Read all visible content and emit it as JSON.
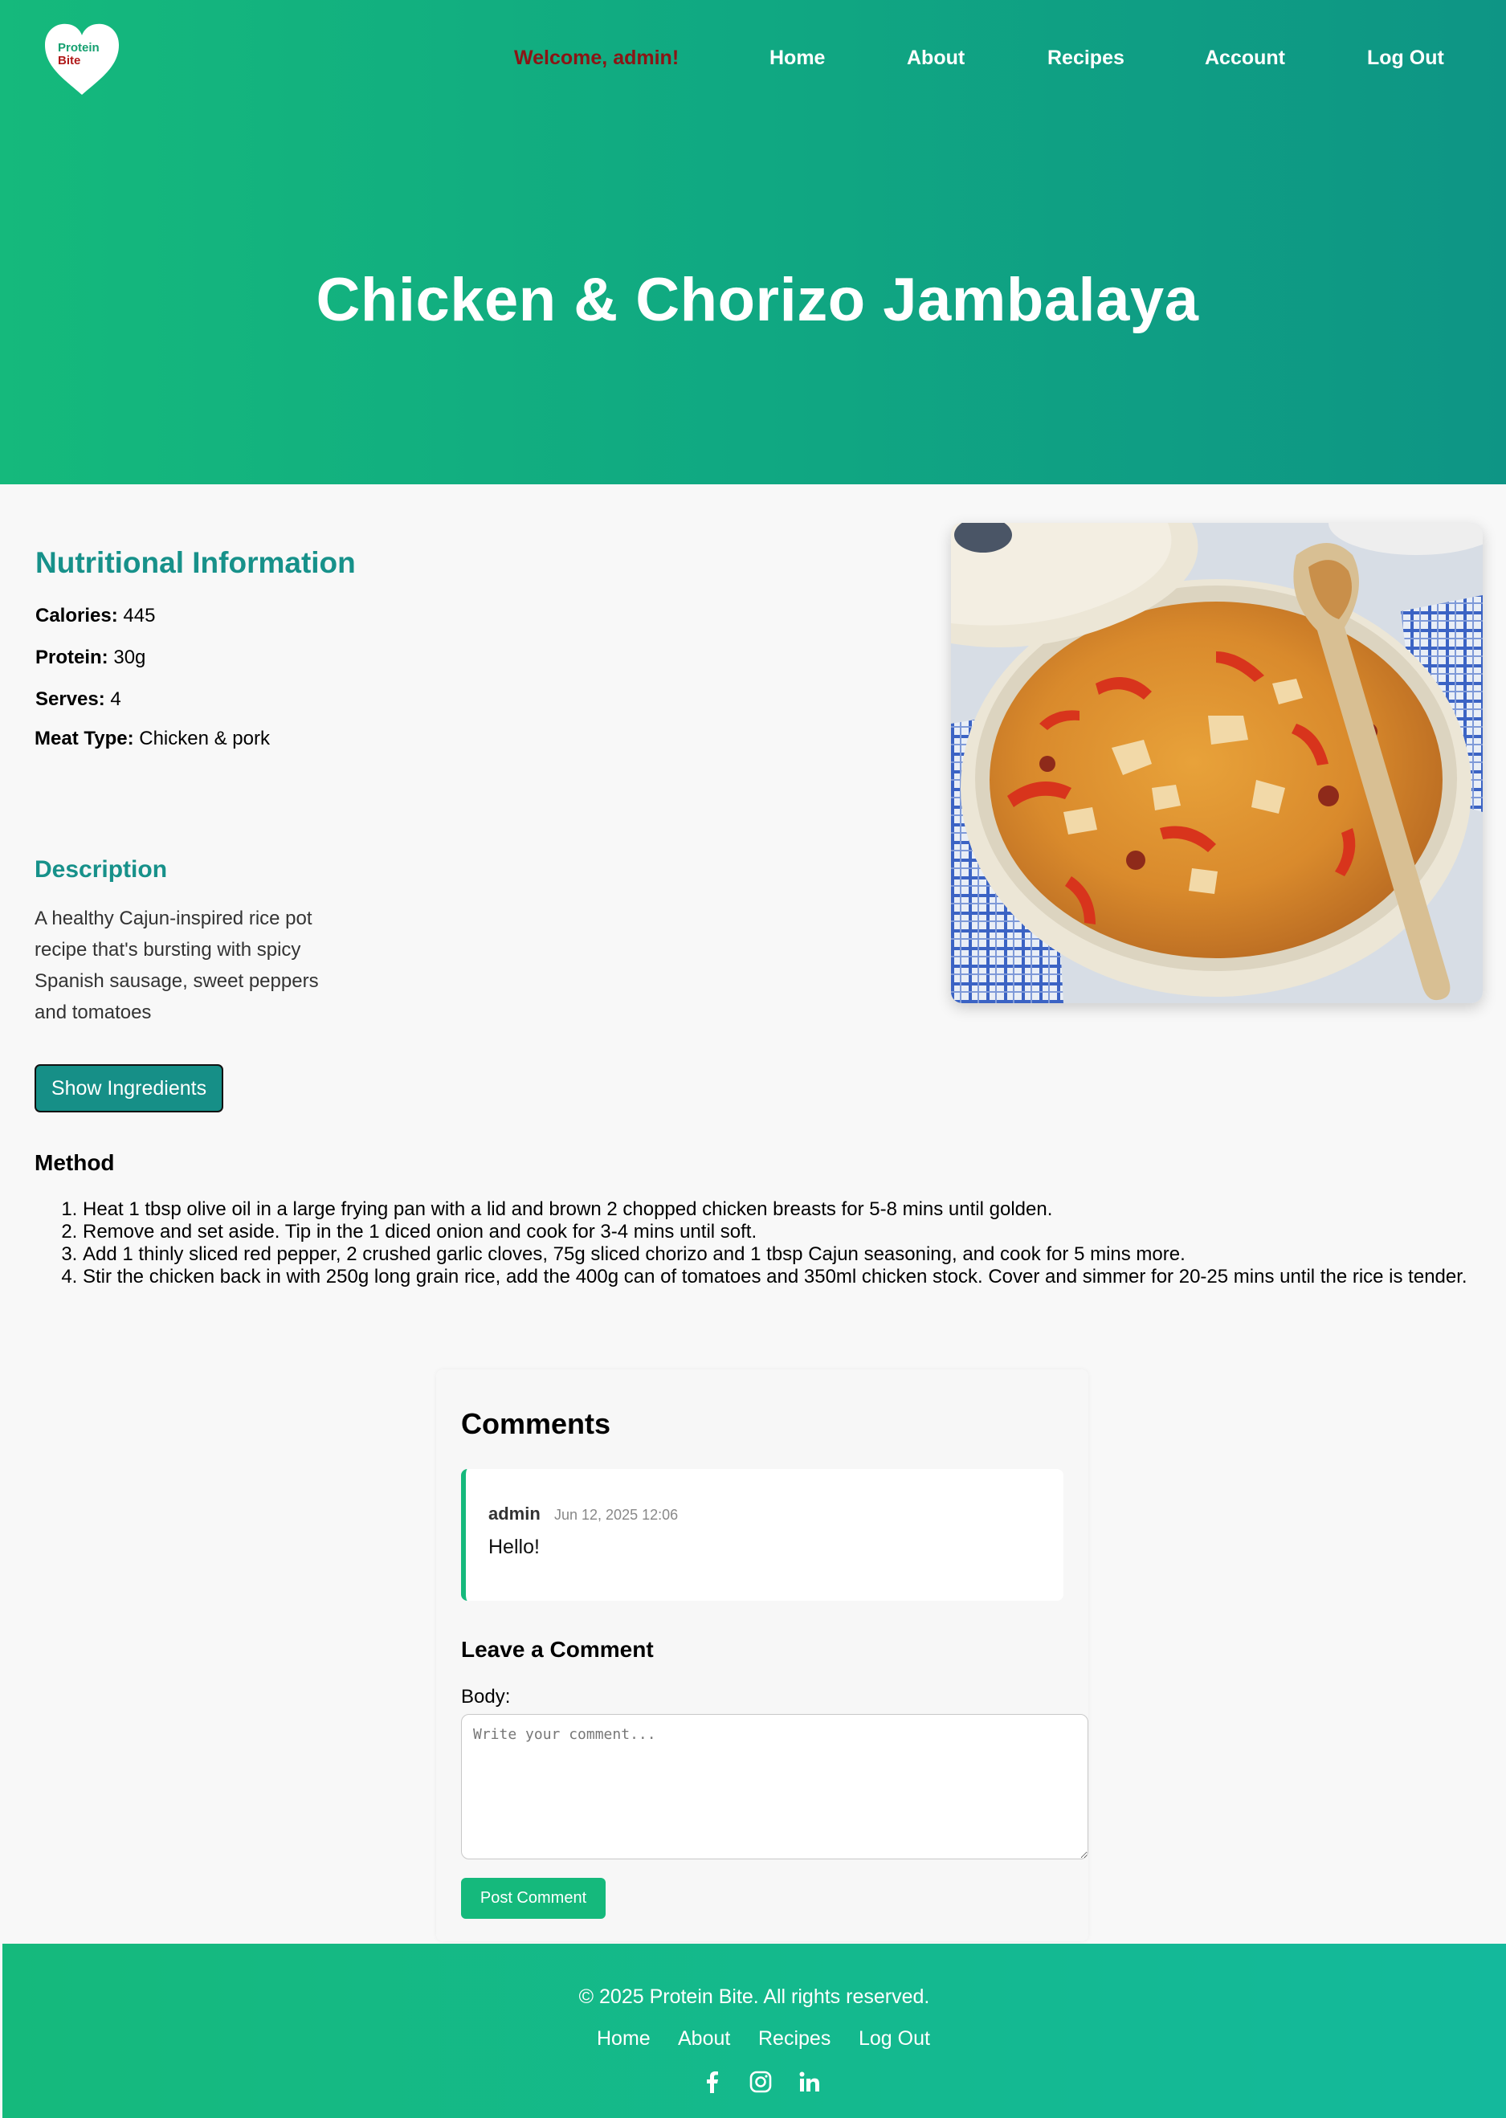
{
  "header": {
    "logo_text_line1": "Protein",
    "logo_text_line2": "Bite",
    "welcome": "Welcome, admin!",
    "nav": [
      {
        "label": "Home"
      },
      {
        "label": "About"
      },
      {
        "label": "Recipes"
      },
      {
        "label": "Account"
      },
      {
        "label": "Log Out"
      }
    ]
  },
  "hero": {
    "title": "Chicken & Chorizo Jambalaya"
  },
  "nutrition": {
    "title": "Nutritional Information",
    "rows": [
      {
        "label": "Calories:",
        "value": "445"
      },
      {
        "label": "Protein:",
        "value": "30g"
      },
      {
        "label": "Serves:",
        "value": "4"
      },
      {
        "label": "Meat Type:",
        "value": "Chicken & pork"
      }
    ]
  },
  "description": {
    "title": "Description",
    "text": "A healthy Cajun-inspired rice pot recipe that's bursting with spicy Spanish sausage, sweet peppers and tomatoes"
  },
  "ingredients_button": "Show Ingredients",
  "method": {
    "title": "Method",
    "steps": [
      "Heat 1 tbsp olive oil in a large frying pan with a lid and brown 2 chopped chicken breasts for 5-8 mins until golden.",
      "Remove and set aside. Tip in the 1 diced onion and cook for 3-4 mins until soft.",
      "Add 1 thinly sliced red pepper, 2 crushed garlic cloves, 75g sliced chorizo and 1 tbsp Cajun seasoning, and cook for 5 mins more.",
      "Stir the chicken back in with 250g long grain rice, add the 400g can of tomatoes and 350ml chicken stock. Cover and simmer for 20-25 mins until the rice is tender."
    ]
  },
  "comments": {
    "title": "Comments",
    "items": [
      {
        "author": "admin",
        "date": "Jun 12, 2025 12:06",
        "body": "Hello!"
      }
    ],
    "form_title": "Leave a Comment",
    "body_label": "Body:",
    "placeholder": "Write your comment...",
    "submit": "Post Comment"
  },
  "footer": {
    "copyright": "© 2025 Protein Bite. All rights reserved.",
    "links": [
      {
        "label": "Home"
      },
      {
        "label": "About"
      },
      {
        "label": "Recipes"
      },
      {
        "label": "Log Out"
      }
    ],
    "social_icons": [
      "facebook-icon",
      "instagram-icon",
      "linkedin-icon"
    ]
  },
  "colors": {
    "brand_green": "#15b97c",
    "teal_heading": "#17918a",
    "welcome_red": "#8b1414"
  }
}
